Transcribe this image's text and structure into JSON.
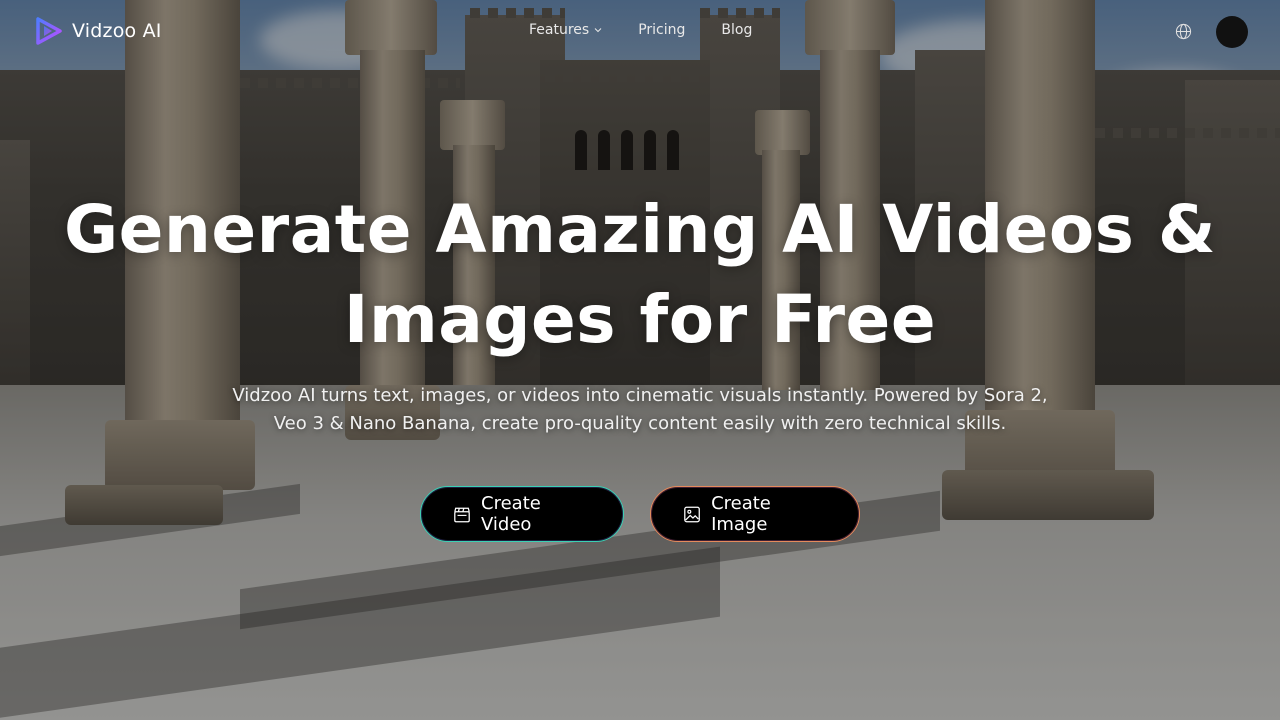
{
  "brand": {
    "name": "Vidzoo AI",
    "logo_icon": "vidzoo-play-logo-icon"
  },
  "nav": {
    "links": [
      {
        "label": "Features",
        "has_dropdown": true
      },
      {
        "label": "Pricing"
      },
      {
        "label": "Blog"
      }
    ],
    "language_icon": "globe-icon",
    "avatar_icon": "user-avatar"
  },
  "hero": {
    "title_line1": "Generate Amazing AI Videos &",
    "title_line2": "Images for Free",
    "subtitle_line1": "Vidzoo AI turns text, images, or videos into cinematic visuals instantly. Powered by Sora 2,",
    "subtitle_line2": "Veo 3 & Nano Banana, create pro-quality content easily with zero technical skills."
  },
  "cta": {
    "video_label": "Create Video",
    "video_icon": "clapperboard-icon",
    "image_label": "Create Image",
    "image_icon": "image-icon"
  },
  "colors": {
    "logo_gradient_start": "#4f7cff",
    "logo_gradient_end": "#c04bff",
    "cta_video_border": "#3ad1b4",
    "cta_image_border": "#e58b5c"
  }
}
